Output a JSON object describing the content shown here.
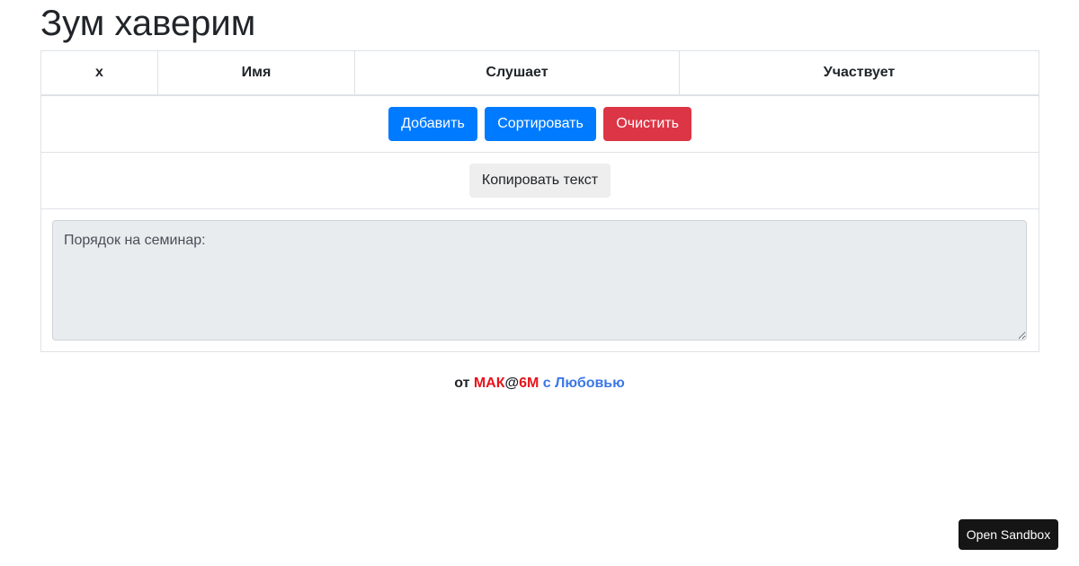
{
  "page": {
    "title": "Зум хаверим"
  },
  "table": {
    "headers": [
      "x",
      "Имя",
      "Слушает",
      "Участвует"
    ]
  },
  "actions": {
    "add_label": "Добавить",
    "sort_label": "Сортировать",
    "clear_label": "Очистить",
    "copy_label": "Копировать текст"
  },
  "notes": {
    "value": "Порядок на семинар:"
  },
  "footer": {
    "from": "от ",
    "brand_part1": "МАК",
    "brand_at": "@",
    "brand_part2": "6М",
    "love": " с Любовью"
  },
  "sandbox": {
    "label": "Open Sandbox"
  },
  "colors": {
    "primary": "#007bff",
    "danger": "#dc3545",
    "brand_red": "#e8141b",
    "love_blue": "#3b78e7"
  }
}
